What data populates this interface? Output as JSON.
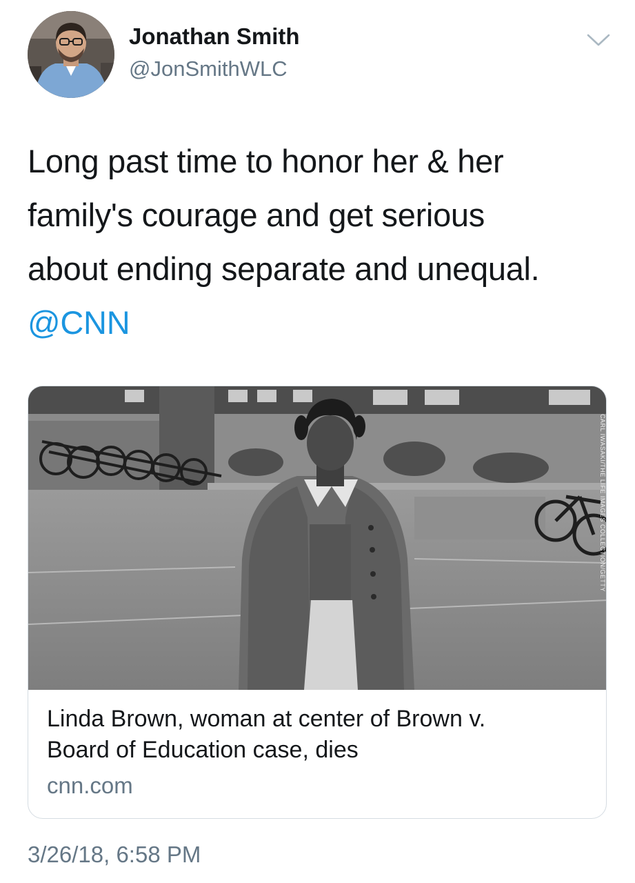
{
  "tweet": {
    "author": {
      "display_name": "Jonathan Smith",
      "handle": "@JonSmithWLC",
      "avatar_icon": "profile-photo"
    },
    "menu_icon": "chevron-down-icon",
    "text_lines": [
      "Long past time to honor her & her",
      "family's courage and get serious",
      "about ending separate and unequal."
    ],
    "mention": "@CNN",
    "timestamp": "3/26/18, 6:58 PM"
  },
  "card": {
    "image_credit": "CARL IWASAKI/THE LIFE IMAGES COLLECTION/GETTY",
    "title_lines": [
      "Linda Brown, woman at center of Brown v.",
      "Board of Education case, dies"
    ],
    "domain": "cnn.com"
  },
  "colors": {
    "text": "#14171a",
    "secondary": "#657786",
    "link": "#1b95e0",
    "border": "#d5dce2"
  }
}
